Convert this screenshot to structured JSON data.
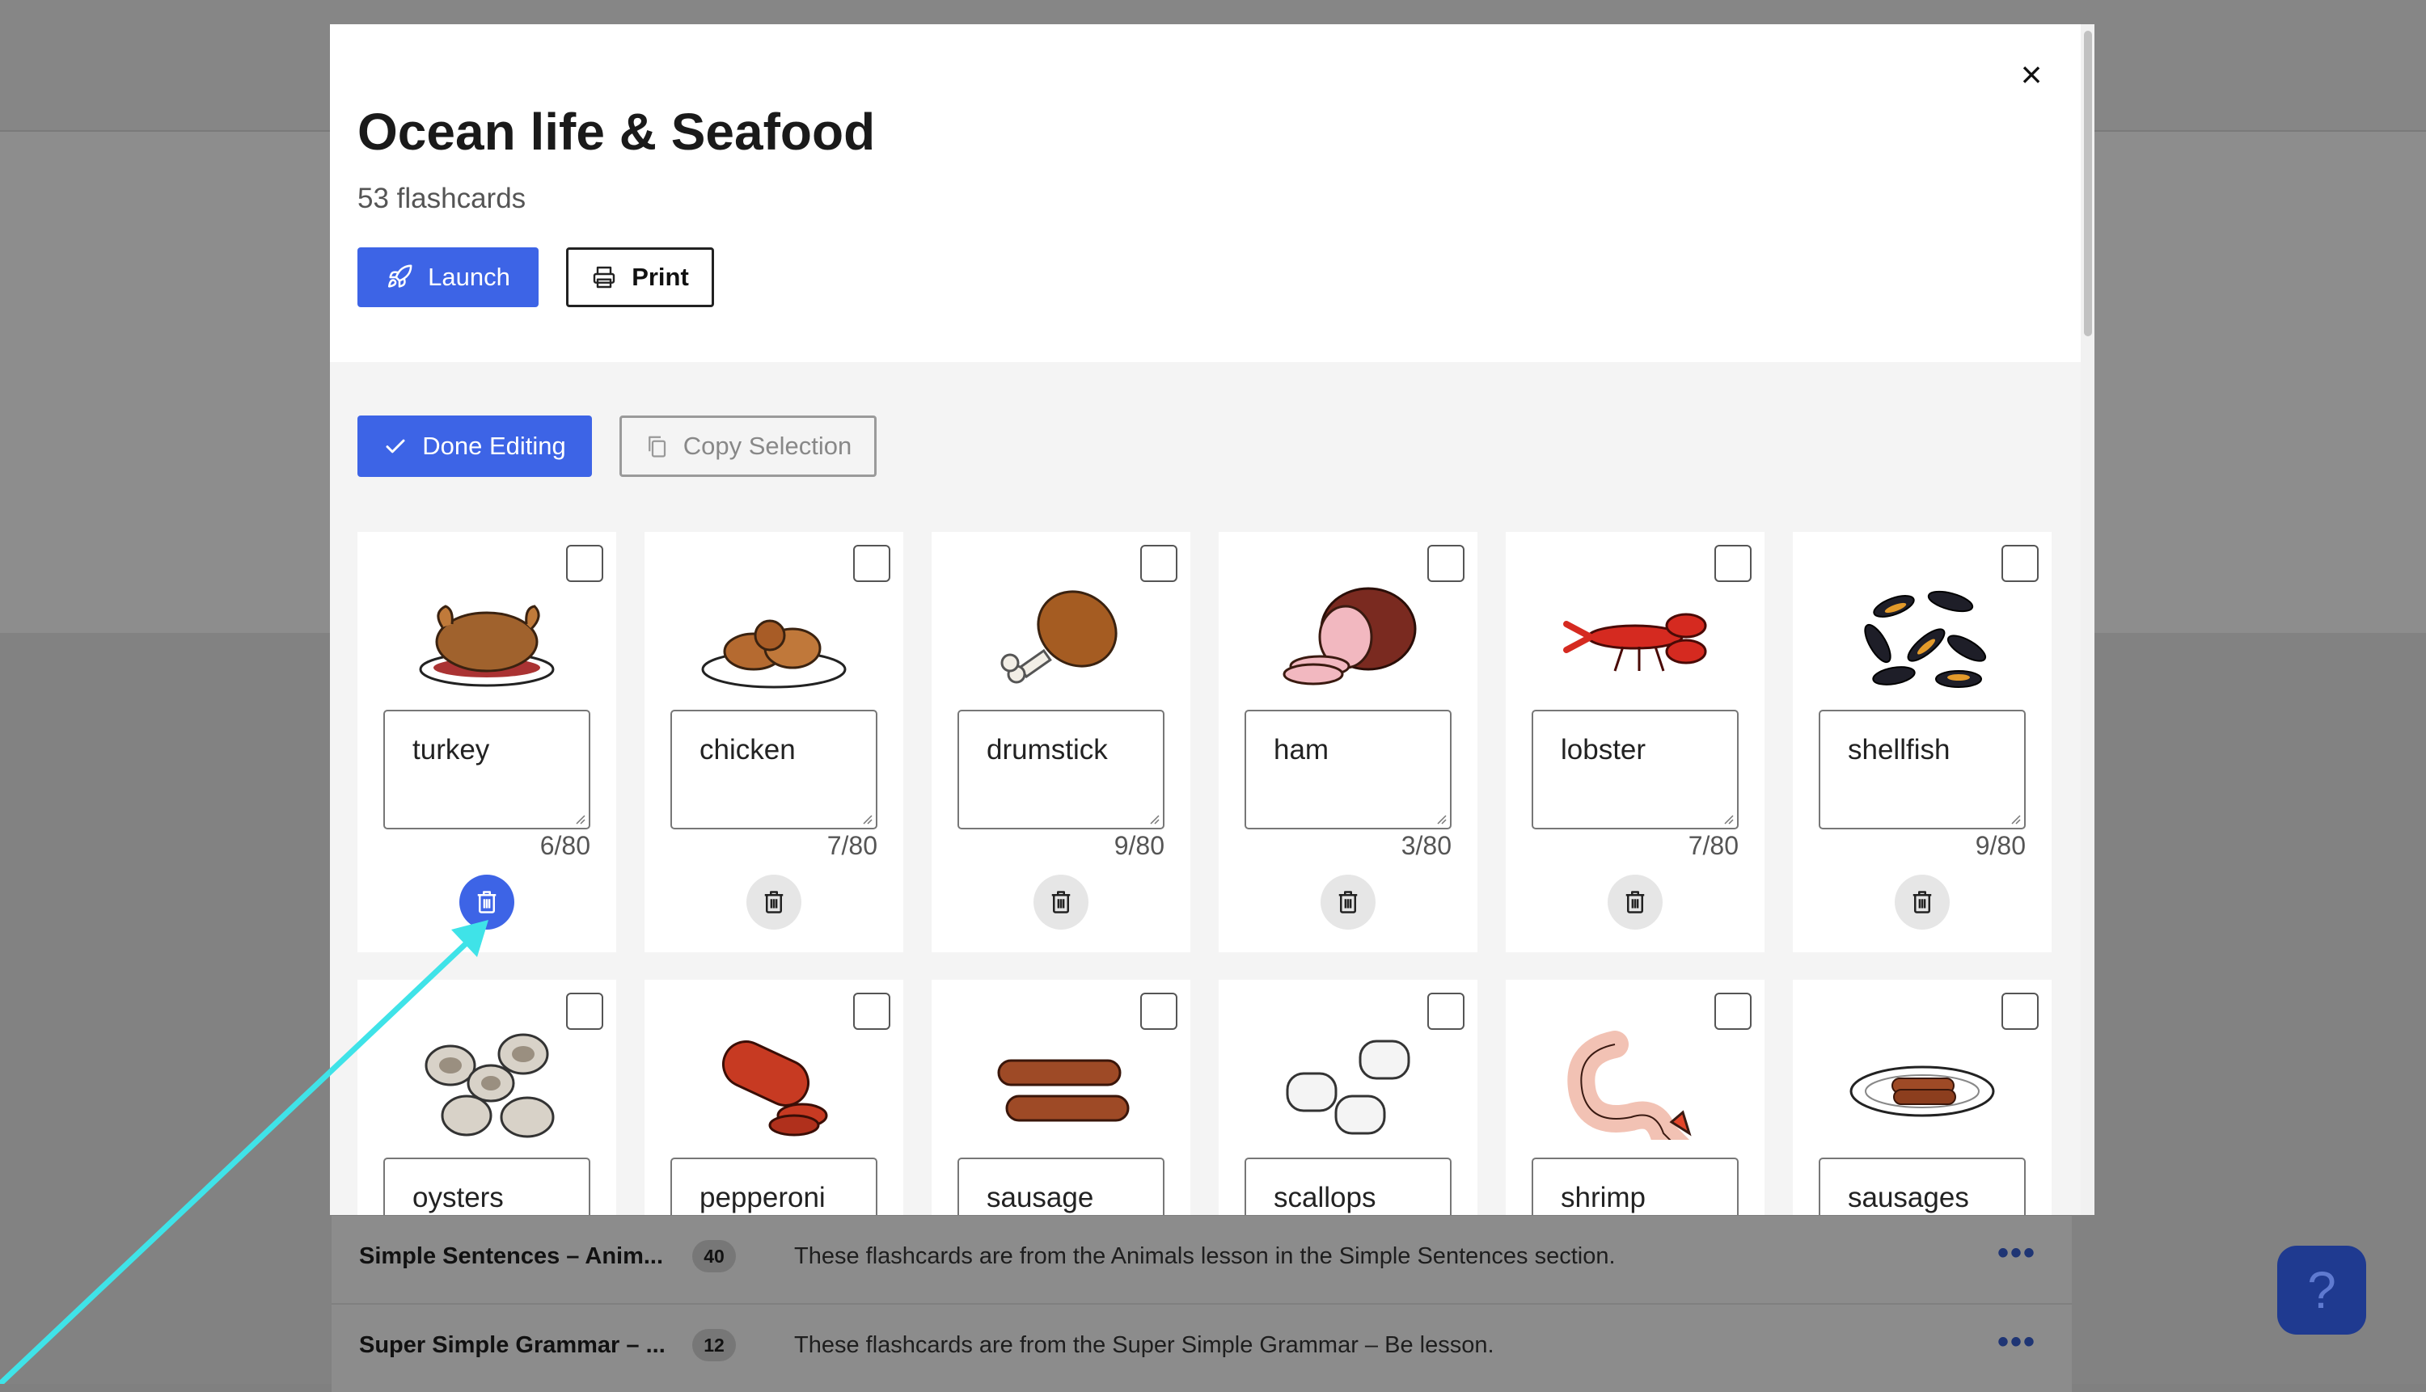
{
  "modal": {
    "title": "Ocean life & Seafood",
    "subtitle": "53 flashcards",
    "close_icon": "×",
    "launch_label": "Launch",
    "print_label": "Print",
    "done_label": "Done Editing",
    "copy_label": "Copy Selection"
  },
  "cards": [
    {
      "word": "turkey",
      "counter": "6/80",
      "icon": "turkey-icon"
    },
    {
      "word": "chicken",
      "counter": "7/80",
      "icon": "chicken-icon"
    },
    {
      "word": "drumstick",
      "counter": "9/80",
      "icon": "drumstick-icon"
    },
    {
      "word": "ham",
      "counter": "3/80",
      "icon": "ham-icon"
    },
    {
      "word": "lobster",
      "counter": "7/80",
      "icon": "lobster-icon"
    },
    {
      "word": "shellfish",
      "counter": "9/80",
      "icon": "shellfish-icon"
    },
    {
      "word": "oysters",
      "icon": "oysters-icon"
    },
    {
      "word": "pepperoni",
      "icon": "pepperoni-icon"
    },
    {
      "word": "sausage",
      "icon": "sausage-icon"
    },
    {
      "word": "scallops",
      "icon": "scallops-icon"
    },
    {
      "word": "shrimp",
      "icon": "shrimp-icon"
    },
    {
      "word": "sausages",
      "icon": "sausages-icon"
    }
  ],
  "background_list": [
    {
      "title": "Simple Sentences – Anim...",
      "count": "40",
      "description": "These flashcards are from the Animals lesson in the Simple Sentences section."
    },
    {
      "title": "Super Simple Grammar – ...",
      "count": "12",
      "description": "These flashcards are from the Super Simple Grammar – Be lesson."
    }
  ],
  "help": {
    "label": "?"
  },
  "colors": {
    "accent": "#3d64e6",
    "annotation_arrow": "#3fe3e8"
  }
}
